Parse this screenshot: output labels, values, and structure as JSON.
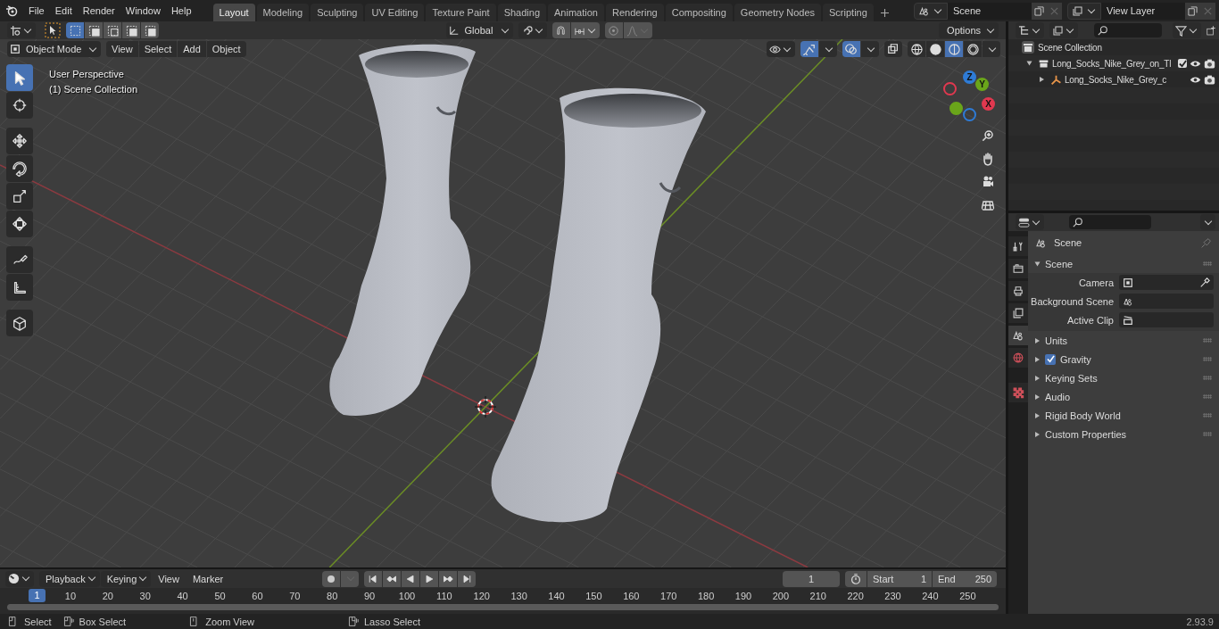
{
  "menu_bar": {
    "items": [
      "File",
      "Edit",
      "Render",
      "Window",
      "Help"
    ]
  },
  "workspace_tabs": [
    {
      "label": "Layout",
      "selected": true
    },
    {
      "label": "Modeling",
      "selected": false
    },
    {
      "label": "Sculpting",
      "selected": false
    },
    {
      "label": "UV Editing",
      "selected": false
    },
    {
      "label": "Texture Paint",
      "selected": false
    },
    {
      "label": "Shading",
      "selected": false
    },
    {
      "label": "Animation",
      "selected": false
    },
    {
      "label": "Rendering",
      "selected": false
    },
    {
      "label": "Compositing",
      "selected": false
    },
    {
      "label": "Geometry Nodes",
      "selected": false
    },
    {
      "label": "Scripting",
      "selected": false
    }
  ],
  "scene_selector": {
    "value": "Scene"
  },
  "view_layer_selector": {
    "value": "View Layer"
  },
  "tool_settings": {
    "select_modes": [
      {
        "kind": "new",
        "selected": true
      },
      {
        "kind": "extend",
        "selected": false
      },
      {
        "kind": "subtract",
        "selected": false
      },
      {
        "kind": "invert",
        "selected": false
      },
      {
        "kind": "intersect",
        "selected": false
      }
    ],
    "transform_orientation": "Global",
    "snap_on": false,
    "proportional_on": false,
    "options": "Options"
  },
  "viewport_header": {
    "mode": "Object Mode",
    "menus": [
      "View",
      "Select",
      "Add",
      "Object"
    ],
    "toggles": [
      {
        "kind": "gizmo",
        "on": true
      },
      {
        "kind": "overlay",
        "on": true
      },
      {
        "kind": "xray",
        "on": false
      }
    ],
    "shading_modes": [
      {
        "kind": "wireframe",
        "selected": false
      },
      {
        "kind": "solid",
        "selected": false
      },
      {
        "kind": "material",
        "selected": true
      },
      {
        "kind": "rendered",
        "selected": false
      }
    ]
  },
  "viewport": {
    "overlay_text": [
      "User Perspective",
      "(1) Scene Collection"
    ],
    "tool_groups": [
      {
        "tools": [
          {
            "kind": "select",
            "selected": true
          },
          {
            "kind": "cursor",
            "selected": false
          }
        ]
      },
      {
        "tools": [
          {
            "kind": "move",
            "selected": false
          },
          {
            "kind": "rotate",
            "selected": false
          },
          {
            "kind": "scale",
            "selected": false
          },
          {
            "kind": "transform",
            "selected": false
          }
        ]
      },
      {
        "tools": [
          {
            "kind": "annotate",
            "selected": false
          },
          {
            "kind": "measure",
            "selected": false
          }
        ]
      },
      {
        "tools": [
          {
            "kind": "add-cube",
            "selected": false
          }
        ]
      }
    ],
    "gizmo_axes": [
      {
        "label": "Z",
        "kind": "z"
      },
      {
        "label": "Y",
        "kind": "y"
      },
      {
        "label": "X",
        "kind": "x"
      }
    ]
  },
  "outliner": {
    "root": "Scene Collection",
    "items": [
      {
        "label": "Long_Socks_Nike_Grey_on_Tl",
        "kind": "collection",
        "expanded": true,
        "checked": true,
        "children": [
          {
            "label": "Long_Socks_Nike_Grey_c",
            "kind": "empty",
            "expanded": false
          }
        ]
      }
    ]
  },
  "properties": {
    "tabs": [
      {
        "kind": "tool",
        "selected": false
      },
      {
        "kind": "render",
        "selected": false
      },
      {
        "kind": "output",
        "selected": false
      },
      {
        "kind": "view-layer",
        "selected": false
      },
      {
        "kind": "scene",
        "selected": true
      },
      {
        "kind": "world",
        "selected": false
      },
      {
        "kind": "texture",
        "selected": false
      }
    ],
    "title": "Scene",
    "panels": [
      {
        "label": "Scene",
        "expanded": true,
        "fields": [
          {
            "label": "Camera",
            "kind": "camera"
          },
          {
            "label": "Background Scene",
            "kind": "scene"
          },
          {
            "label": "Active Clip",
            "kind": "clip"
          }
        ]
      },
      {
        "label": "Units",
        "expanded": false
      },
      {
        "label": "Gravity",
        "expanded": false,
        "checked": true
      },
      {
        "label": "Keying Sets",
        "expanded": false
      },
      {
        "label": "Audio",
        "expanded": false
      },
      {
        "label": "Rigid Body World",
        "expanded": false
      },
      {
        "label": "Custom Properties",
        "expanded": false
      }
    ]
  },
  "timeline": {
    "menus": [
      {
        "label": "Playback",
        "dropdown": true
      },
      {
        "label": "Keying",
        "dropdown": true
      },
      {
        "label": "View",
        "dropdown": false
      },
      {
        "label": "Marker",
        "dropdown": false
      }
    ],
    "auto_keying_on": false,
    "current_frame": "1",
    "start_label": "Start",
    "start": "1",
    "end_label": "End",
    "end": "250",
    "playhead": "1",
    "ticks": [
      "10",
      "20",
      "30",
      "40",
      "50",
      "60",
      "70",
      "80",
      "90",
      "100",
      "110",
      "120",
      "130",
      "140",
      "150",
      "160",
      "170",
      "180",
      "190",
      "200",
      "210",
      "220",
      "230",
      "240",
      "250"
    ]
  },
  "status_bar": {
    "hints": [
      {
        "label": "Select",
        "kind": "left"
      },
      {
        "label": "Box Select",
        "kind": "left-drag"
      },
      {
        "label": "Zoom View",
        "kind": "middle"
      },
      {
        "label": "Lasso Select",
        "kind": "right-drag"
      }
    ],
    "version": "2.93.9"
  }
}
